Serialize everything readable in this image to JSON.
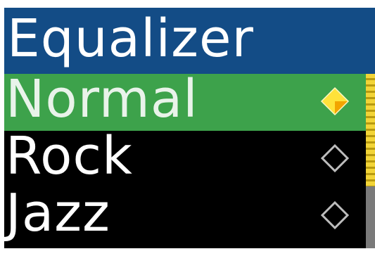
{
  "header": {
    "title": "Equalizer"
  },
  "menu": {
    "items": [
      {
        "label": "Normal",
        "selected": true,
        "icon": "diamond-radio-filled-icon"
      },
      {
        "label": "Rock",
        "selected": false,
        "icon": "diamond-radio-empty-icon"
      },
      {
        "label": "Jazz",
        "selected": false,
        "icon": "diamond-radio-empty-icon"
      }
    ]
  },
  "colors": {
    "header_bg": "#134c86",
    "selected_row_bg": "#3da24b",
    "list_bg": "#000000",
    "text": "#ffffff",
    "radio_selected": "#ffe23a",
    "radio_selected_shade": "#f2a400",
    "radio_empty": "#bdbdbd",
    "scroll_thumb": "#f2d437",
    "scroll_track": "#7a7a7a"
  }
}
